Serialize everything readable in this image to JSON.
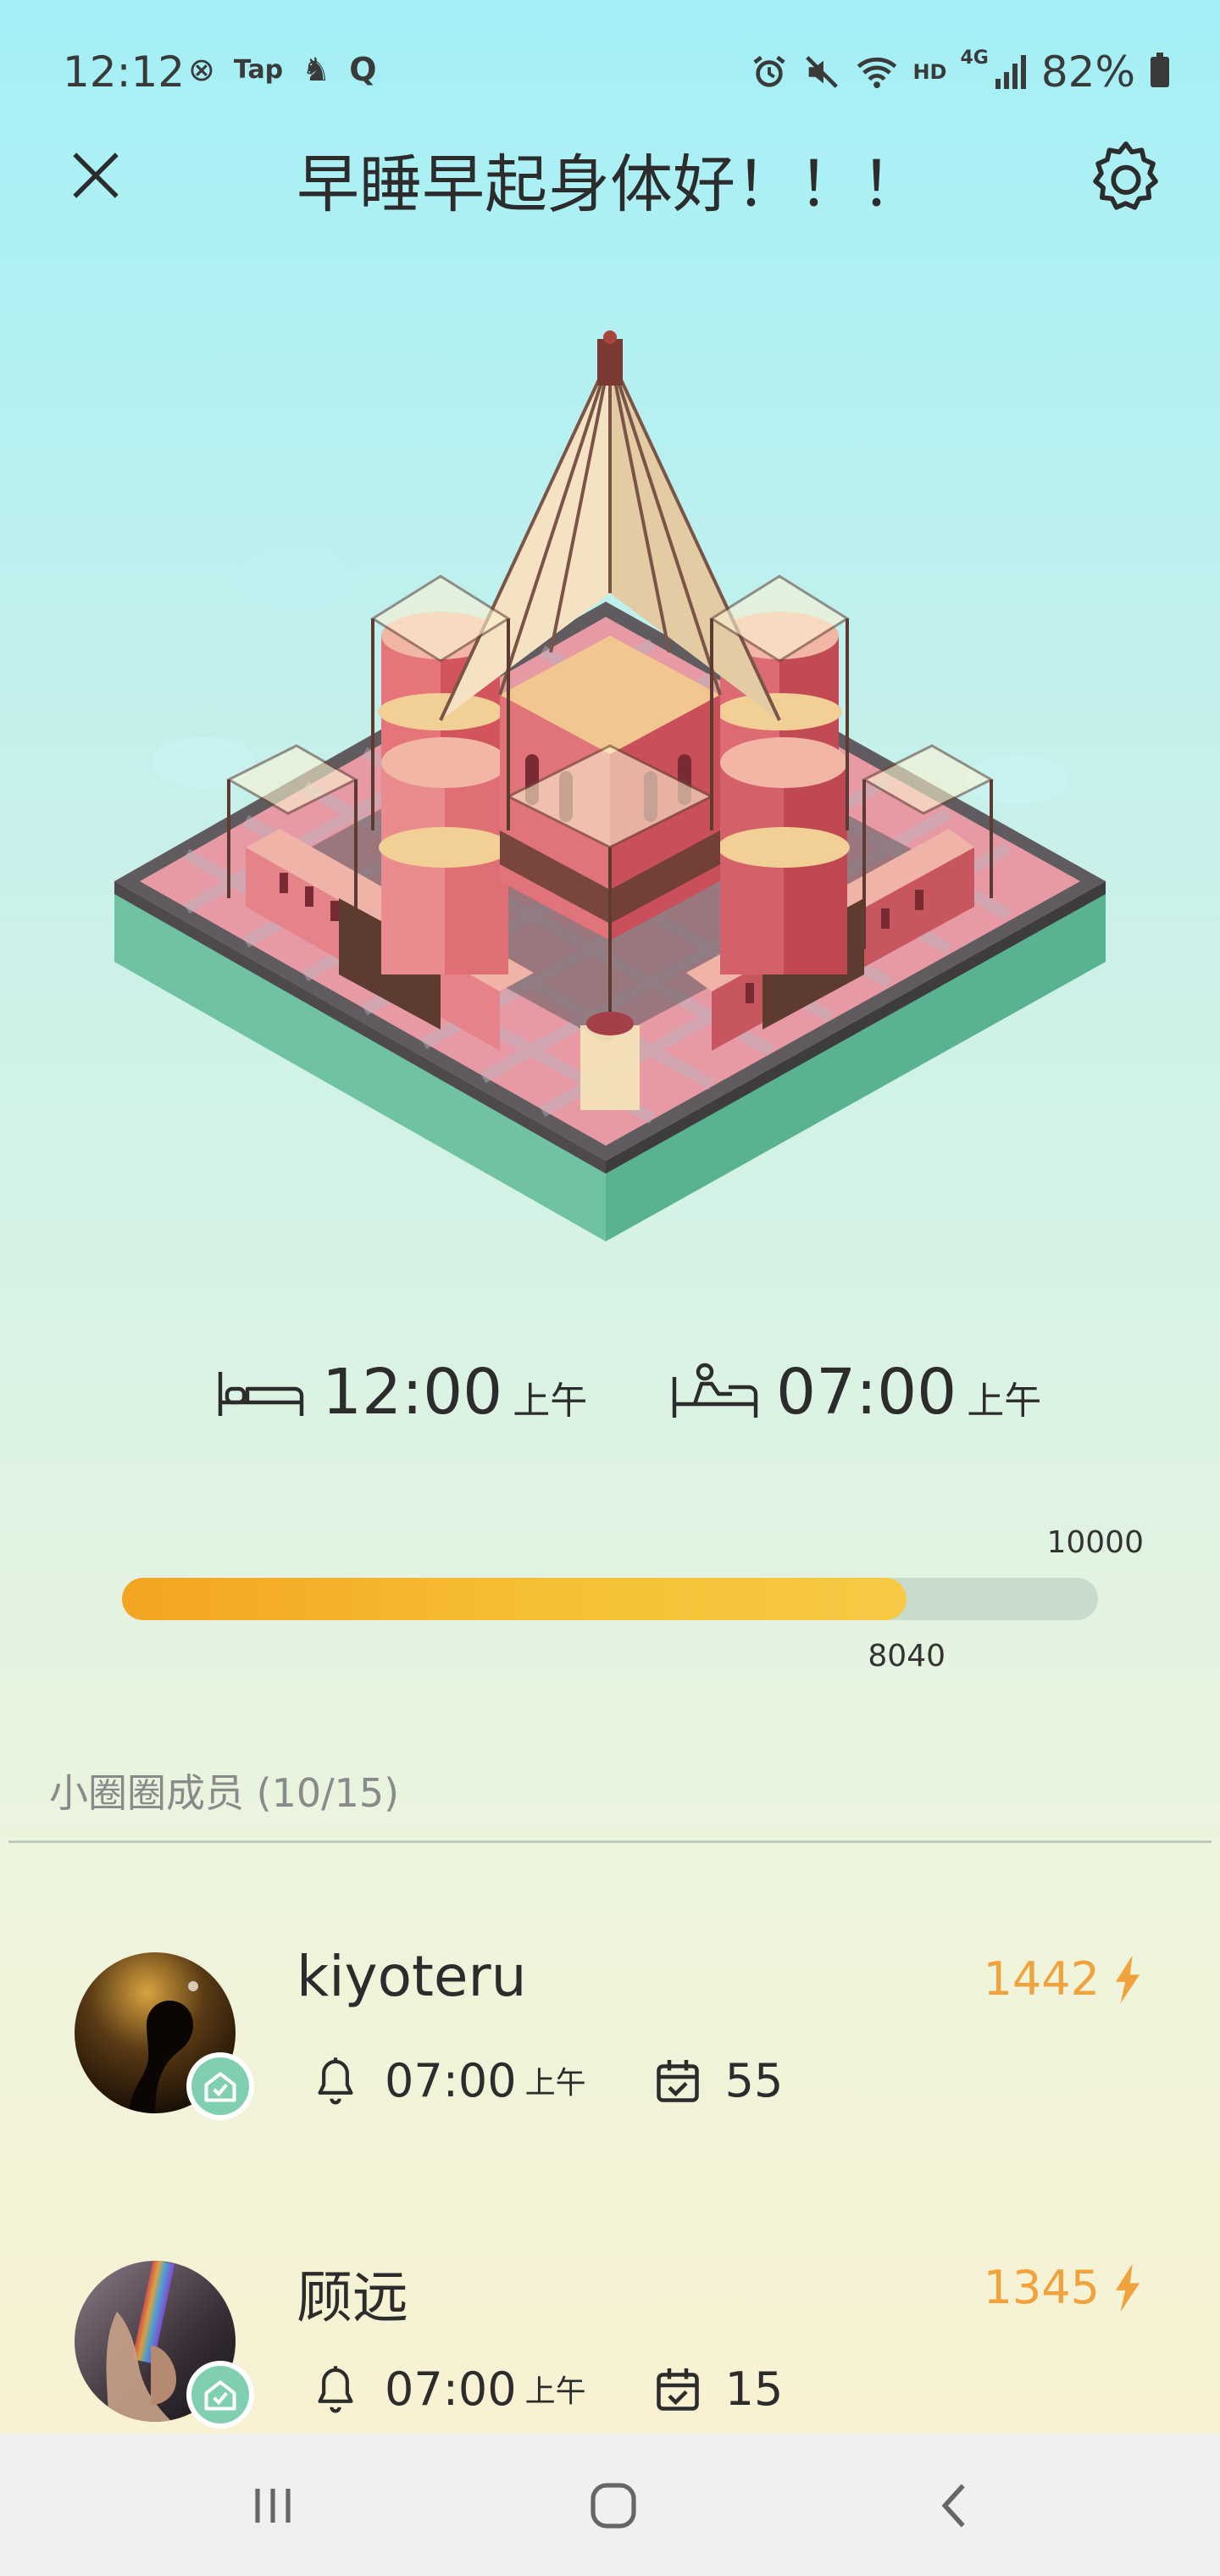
{
  "status_bar": {
    "time": "12:12",
    "left_icons": [
      "weibo-icon",
      "tap-icon",
      "figure-icon",
      "q-icon"
    ],
    "left_icon_labels": [
      "⊗",
      "Tap",
      "♞",
      "Q"
    ],
    "right_icons": [
      "alarm-icon",
      "mute-icon",
      "wifi-icon",
      "hd-icon",
      "signal-4g-icon"
    ],
    "right_icon_labels": [
      "⏰",
      "🔇",
      "WiFi",
      "HD",
      "4G"
    ],
    "battery": "82%"
  },
  "header": {
    "title": "早睡早起身体好！！！",
    "close_icon": "close-icon",
    "settings_icon": "gear-icon"
  },
  "schedule": {
    "bed": {
      "icon": "bed-icon",
      "time": "12:00",
      "ampm": "上午"
    },
    "wake": {
      "icon": "wake-up-icon",
      "time": "07:00",
      "ampm": "上午"
    }
  },
  "progress": {
    "max_label": "10000",
    "current_label": "8040",
    "max": 10000,
    "current": 8040
  },
  "members": {
    "heading": "小圈圈成员 (10/15)",
    "items": [
      {
        "name": "kiyoteru",
        "energy": "1442",
        "alarm_time": "07:00",
        "alarm_ampm": "上午",
        "days": "55",
        "avatar_colors": [
          "#c99a3a",
          "#2a1a0a"
        ]
      },
      {
        "name": "顾远",
        "energy": "1345",
        "alarm_time": "07:00",
        "alarm_ampm": "上午",
        "days": "15",
        "avatar_colors": [
          "#6b5a6e",
          "#1c1a22"
        ]
      }
    ]
  },
  "nav_bar": {
    "buttons": [
      "recent-apps-icon",
      "home-icon",
      "back-icon"
    ]
  },
  "colors": {
    "accent_energy": "#f0a23c",
    "progress_start": "#f3a423",
    "progress_end": "#f8c944",
    "badge_green": "#7fcfb0"
  }
}
